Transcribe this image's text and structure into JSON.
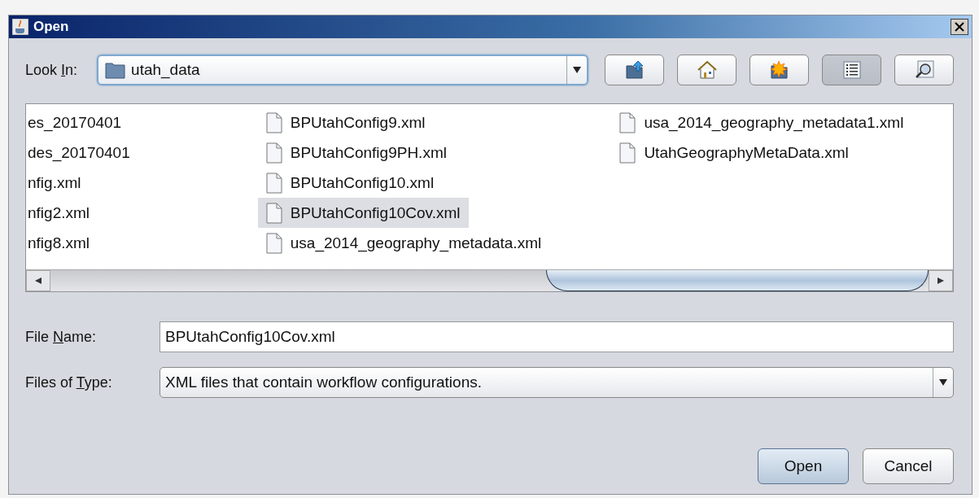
{
  "window": {
    "title": "Open"
  },
  "look_in": {
    "label": [
      {
        "text": "Look ",
        "underlined": false
      },
      {
        "text": "I",
        "underlined": true
      },
      {
        "text": "n:",
        "underlined": false
      }
    ],
    "value": "utah_data"
  },
  "toolbar": [
    {
      "kind": "up",
      "selected": false
    },
    {
      "kind": "home",
      "selected": false
    },
    {
      "kind": "new-folder",
      "selected": false
    },
    {
      "kind": "details",
      "selected": true
    },
    {
      "kind": "preview",
      "selected": false
    }
  ],
  "file_columns": [
    {
      "items": [
        {
          "name": "es_20170401",
          "kind": "clipped",
          "selected": false
        },
        {
          "name": "des_20170401",
          "kind": "clipped",
          "selected": false
        },
        {
          "name": "nfig.xml",
          "kind": "clipped",
          "selected": false
        },
        {
          "name": "nfig2.xml",
          "kind": "clipped",
          "selected": false
        },
        {
          "name": "nfig8.xml",
          "kind": "clipped",
          "selected": false
        }
      ]
    },
    {
      "items": [
        {
          "name": "BPUtahConfig9.xml",
          "kind": "file",
          "selected": false
        },
        {
          "name": "BPUtahConfig9PH.xml",
          "kind": "file",
          "selected": false
        },
        {
          "name": "BPUtahConfig10.xml",
          "kind": "file",
          "selected": false
        },
        {
          "name": "BPUtahConfig10Cov.xml",
          "kind": "file",
          "selected": true
        },
        {
          "name": "usa_2014_geography_metadata.xml",
          "kind": "file",
          "selected": false
        }
      ]
    },
    {
      "items": [
        {
          "name": "usa_2014_geography_metadata1.xml",
          "kind": "file",
          "selected": false
        },
        {
          "name": "UtahGeographyMetaData.xml",
          "kind": "file",
          "selected": false
        }
      ]
    }
  ],
  "file_name": {
    "label": [
      {
        "text": "File ",
        "underlined": false
      },
      {
        "text": "N",
        "underlined": true
      },
      {
        "text": "ame:",
        "underlined": false
      }
    ],
    "value": "BPUtahConfig10Cov.xml"
  },
  "files_of_type": {
    "label": [
      {
        "text": "Files of ",
        "underlined": false
      },
      {
        "text": "T",
        "underlined": true
      },
      {
        "text": "ype:",
        "underlined": false
      }
    ],
    "value": "XML files that contain workflow configurations."
  },
  "buttons": [
    {
      "label": "Open",
      "default": true
    },
    {
      "label": "Cancel",
      "default": false
    }
  ]
}
